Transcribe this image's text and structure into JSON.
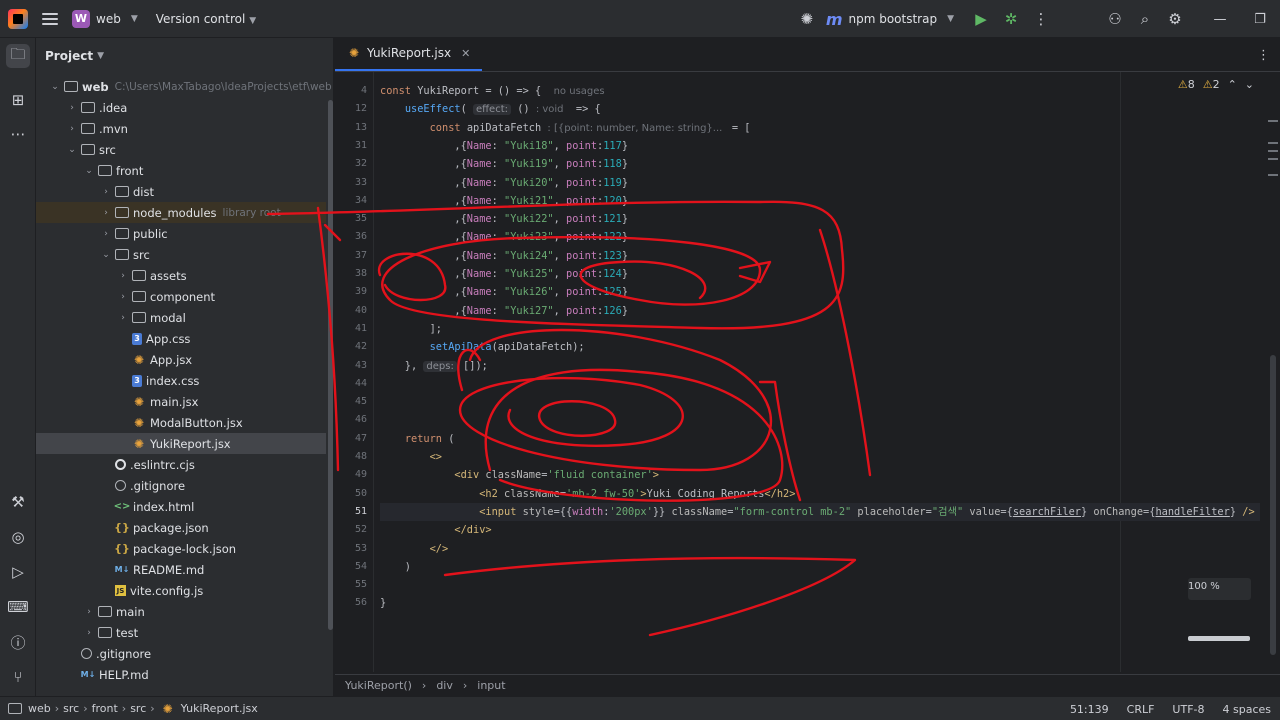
{
  "titlebar": {
    "project_badge": "W",
    "project_name": "web",
    "vcs": "Version control",
    "run_config": "npm bootstrap",
    "run_config_icon": "m"
  },
  "project_panel": {
    "title": "Project"
  },
  "tree": [
    {
      "label": "web",
      "hint": "C:\\Users\\MaxTabago\\IdeaProjects\\etf\\web",
      "icon": "folder",
      "depth": 0,
      "open": true,
      "bold": true
    },
    {
      "label": ".idea",
      "icon": "folder",
      "depth": 1,
      "open": false
    },
    {
      "label": ".mvn",
      "icon": "folder",
      "depth": 1,
      "open": false
    },
    {
      "label": "src",
      "icon": "folder",
      "depth": 1,
      "open": true
    },
    {
      "label": "front",
      "icon": "folder",
      "depth": 2,
      "open": true
    },
    {
      "label": "dist",
      "icon": "folder",
      "depth": 3,
      "open": false
    },
    {
      "label": "node_modules",
      "hint": "library root",
      "icon": "folder",
      "depth": 3,
      "open": false,
      "lib": true
    },
    {
      "label": "public",
      "icon": "folder",
      "depth": 3,
      "open": false
    },
    {
      "label": "src",
      "icon": "folder",
      "depth": 3,
      "open": true
    },
    {
      "label": "assets",
      "icon": "folder",
      "depth": 4,
      "open": false
    },
    {
      "label": "component",
      "icon": "folder",
      "depth": 4,
      "open": false
    },
    {
      "label": "modal",
      "icon": "folder",
      "depth": 4,
      "open": false
    },
    {
      "label": "App.css",
      "icon": "css",
      "depth": 4
    },
    {
      "label": "App.jsx",
      "icon": "jsx",
      "depth": 4
    },
    {
      "label": "index.css",
      "icon": "css",
      "depth": 4
    },
    {
      "label": "main.jsx",
      "icon": "jsx",
      "depth": 4
    },
    {
      "label": "ModalButton.jsx",
      "icon": "jsx",
      "depth": 4
    },
    {
      "label": "YukiReport.jsx",
      "icon": "jsx",
      "depth": 4,
      "selected": true
    },
    {
      "label": ".eslintrc.cjs",
      "icon": "cfg",
      "depth": 3
    },
    {
      "label": ".gitignore",
      "icon": "git",
      "depth": 3
    },
    {
      "label": "index.html",
      "icon": "html",
      "depth": 3
    },
    {
      "label": "package.json",
      "icon": "json",
      "depth": 3
    },
    {
      "label": "package-lock.json",
      "icon": "json",
      "depth": 3
    },
    {
      "label": "README.md",
      "icon": "md",
      "depth": 3
    },
    {
      "label": "vite.config.js",
      "icon": "js",
      "depth": 3
    },
    {
      "label": "main",
      "icon": "folder",
      "depth": 2,
      "open": false
    },
    {
      "label": "test",
      "icon": "folder",
      "depth": 2,
      "open": false
    },
    {
      "label": ".gitignore",
      "icon": "git",
      "depth": 1
    },
    {
      "label": "HELP.md",
      "icon": "md",
      "depth": 1
    }
  ],
  "editor": {
    "tab": "YukiReport.jsx",
    "warnings": "8",
    "weak_warnings": "2",
    "zoom": "100 %",
    "current_line": "51",
    "lines": [
      {
        "n": "4",
        "segs": [
          [
            "kw",
            "const "
          ],
          [
            "",
            "YukiReport = () => {  "
          ],
          [
            "hint",
            "no usages"
          ]
        ]
      },
      {
        "n": "12",
        "segs": [
          [
            "",
            "    "
          ],
          [
            "fn",
            "useEffect"
          ],
          [
            "",
            "( "
          ],
          [
            "hintbox",
            "effect:"
          ],
          [
            "",
            " () "
          ],
          [
            "hint",
            ": void"
          ],
          [
            "",
            "  => {"
          ]
        ]
      },
      {
        "n": "13",
        "segs": [
          [
            "",
            "        "
          ],
          [
            "kw",
            "const "
          ],
          [
            "",
            "apiDataFetch "
          ],
          [
            "hint",
            ": [{point: number, Name: string}...   "
          ],
          [
            "",
            "= ["
          ]
        ]
      },
      {
        "n": "31",
        "segs": [
          [
            "",
            "            ,{"
          ],
          [
            "prop",
            "Name"
          ],
          [
            "",
            ": "
          ],
          [
            "str",
            "\"Yuki18\""
          ],
          [
            "",
            ", "
          ],
          [
            "prop",
            "point"
          ],
          [
            "",
            ":"
          ],
          [
            "num",
            "117"
          ],
          [
            "",
            "}"
          ]
        ]
      },
      {
        "n": "32",
        "segs": [
          [
            "",
            "            ,{"
          ],
          [
            "prop",
            "Name"
          ],
          [
            "",
            ": "
          ],
          [
            "str",
            "\"Yuki19\""
          ],
          [
            "",
            ", "
          ],
          [
            "prop",
            "point"
          ],
          [
            "",
            ":"
          ],
          [
            "num",
            "118"
          ],
          [
            "",
            "}"
          ]
        ]
      },
      {
        "n": "33",
        "segs": [
          [
            "",
            "            ,{"
          ],
          [
            "prop",
            "Name"
          ],
          [
            "",
            ": "
          ],
          [
            "str",
            "\"Yuki20\""
          ],
          [
            "",
            ", "
          ],
          [
            "prop",
            "point"
          ],
          [
            "",
            ":"
          ],
          [
            "num",
            "119"
          ],
          [
            "",
            "}"
          ]
        ]
      },
      {
        "n": "34",
        "segs": [
          [
            "",
            "            ,{"
          ],
          [
            "prop",
            "Name"
          ],
          [
            "",
            ": "
          ],
          [
            "str",
            "\"Yuki21\""
          ],
          [
            "",
            ", "
          ],
          [
            "prop",
            "point"
          ],
          [
            "",
            ":"
          ],
          [
            "num",
            "120"
          ],
          [
            "",
            "}"
          ]
        ]
      },
      {
        "n": "35",
        "segs": [
          [
            "",
            "            ,{"
          ],
          [
            "prop",
            "Name"
          ],
          [
            "",
            ": "
          ],
          [
            "str",
            "\"Yuki22\""
          ],
          [
            "",
            ", "
          ],
          [
            "prop",
            "point"
          ],
          [
            "",
            ":"
          ],
          [
            "num",
            "121"
          ],
          [
            "",
            "}"
          ]
        ]
      },
      {
        "n": "36",
        "segs": [
          [
            "",
            "            ,{"
          ],
          [
            "prop",
            "Name"
          ],
          [
            "",
            ": "
          ],
          [
            "str",
            "\"Yuki23\""
          ],
          [
            "",
            ", "
          ],
          [
            "prop",
            "point"
          ],
          [
            "",
            ":"
          ],
          [
            "num",
            "122"
          ],
          [
            "",
            "}"
          ]
        ]
      },
      {
        "n": "37",
        "segs": [
          [
            "",
            "            ,{"
          ],
          [
            "prop",
            "Name"
          ],
          [
            "",
            ": "
          ],
          [
            "str",
            "\"Yuki24\""
          ],
          [
            "",
            ", "
          ],
          [
            "prop",
            "point"
          ],
          [
            "",
            ":"
          ],
          [
            "num",
            "123"
          ],
          [
            "",
            "}"
          ]
        ]
      },
      {
        "n": "38",
        "segs": [
          [
            "",
            "            ,{"
          ],
          [
            "prop",
            "Name"
          ],
          [
            "",
            ": "
          ],
          [
            "str",
            "\"Yuki25\""
          ],
          [
            "",
            ", "
          ],
          [
            "prop",
            "point"
          ],
          [
            "",
            ":"
          ],
          [
            "num",
            "124"
          ],
          [
            "",
            "}"
          ]
        ]
      },
      {
        "n": "39",
        "segs": [
          [
            "",
            "            ,{"
          ],
          [
            "prop",
            "Name"
          ],
          [
            "",
            ": "
          ],
          [
            "str",
            "\"Yuki26\""
          ],
          [
            "",
            ", "
          ],
          [
            "prop",
            "point"
          ],
          [
            "",
            ":"
          ],
          [
            "num",
            "125"
          ],
          [
            "",
            "}"
          ]
        ]
      },
      {
        "n": "40",
        "segs": [
          [
            "",
            "            ,{"
          ],
          [
            "prop",
            "Name"
          ],
          [
            "",
            ": "
          ],
          [
            "str",
            "\"Yuki27\""
          ],
          [
            "",
            ", "
          ],
          [
            "prop",
            "point"
          ],
          [
            "",
            ":"
          ],
          [
            "num",
            "126"
          ],
          [
            "",
            "}"
          ]
        ]
      },
      {
        "n": "41",
        "segs": [
          [
            "",
            "        ];"
          ]
        ]
      },
      {
        "n": "42",
        "segs": [
          [
            "",
            "        "
          ],
          [
            "fn",
            "setApiData"
          ],
          [
            "",
            "(apiDataFetch);"
          ]
        ]
      },
      {
        "n": "43",
        "segs": [
          [
            "",
            "    }, "
          ],
          [
            "hintbox",
            "deps:"
          ],
          [
            "",
            " []);"
          ]
        ]
      },
      {
        "n": "44",
        "segs": []
      },
      {
        "n": "45",
        "segs": []
      },
      {
        "n": "46",
        "segs": []
      },
      {
        "n": "47",
        "segs": [
          [
            "",
            "    "
          ],
          [
            "kw",
            "return "
          ],
          [
            "",
            "("
          ]
        ]
      },
      {
        "n": "48",
        "segs": [
          [
            "",
            "        "
          ],
          [
            "tag",
            "<>"
          ]
        ]
      },
      {
        "n": "49",
        "segs": [
          [
            "",
            "            "
          ],
          [
            "tag",
            "<div "
          ],
          [
            "attr",
            "className"
          ],
          [
            "",
            "="
          ],
          [
            "str",
            "'fluid container'"
          ],
          [
            "tag",
            ">"
          ]
        ]
      },
      {
        "n": "50",
        "segs": [
          [
            "",
            "                "
          ],
          [
            "tag",
            "<h2 "
          ],
          [
            "attr",
            "className"
          ],
          [
            "",
            "="
          ],
          [
            "str",
            "'mb-2 fw-50'"
          ],
          [
            "tag",
            ">"
          ],
          [
            "",
            "Yuki Coding Reports"
          ],
          [
            "tag",
            "</h2>"
          ]
        ]
      },
      {
        "n": "51",
        "segs": [
          [
            "",
            "                "
          ],
          [
            "tag",
            "<input "
          ],
          [
            "attr",
            "style"
          ],
          [
            "",
            "={{"
          ],
          [
            "prop",
            "width"
          ],
          [
            "",
            ":"
          ],
          [
            "str",
            "'200px'"
          ],
          [
            "",
            "}} "
          ],
          [
            "attr",
            "className"
          ],
          [
            "",
            "="
          ],
          [
            "str",
            "\"form-control mb-2\""
          ],
          [
            "attr",
            " placeholder"
          ],
          [
            "",
            "="
          ],
          [
            "str",
            "\"검색\""
          ],
          [
            "attr",
            " value"
          ],
          [
            "",
            "={"
          ],
          [
            "lnk",
            "searchFiler"
          ],
          [
            "",
            "} "
          ],
          [
            "attr",
            "onChange"
          ],
          [
            "",
            "={"
          ],
          [
            "lnk",
            "handleFilter"
          ],
          [
            "",
            "} "
          ],
          [
            "tag",
            "/>"
          ]
        ]
      },
      {
        "n": "52",
        "segs": [
          [
            "",
            "            "
          ],
          [
            "tag",
            "</div>"
          ]
        ]
      },
      {
        "n": "53",
        "segs": [
          [
            "",
            "        "
          ],
          [
            "tag",
            "</>"
          ]
        ]
      },
      {
        "n": "54",
        "segs": [
          [
            "",
            "    )"
          ]
        ]
      },
      {
        "n": "55",
        "segs": []
      },
      {
        "n": "56",
        "segs": [
          [
            "",
            "}"
          ]
        ]
      }
    ]
  },
  "breadcrumb": [
    "YukiReport()",
    "div",
    "input"
  ],
  "statusbar": {
    "path": [
      "web",
      "src",
      "front",
      "src",
      "YukiReport.jsx"
    ],
    "position": "51:139",
    "line_sep": "CRLF",
    "encoding": "UTF-8",
    "indent": "4 spaces"
  },
  "colors": {
    "accent": "#3574f0",
    "annotation": "#e3121b"
  }
}
